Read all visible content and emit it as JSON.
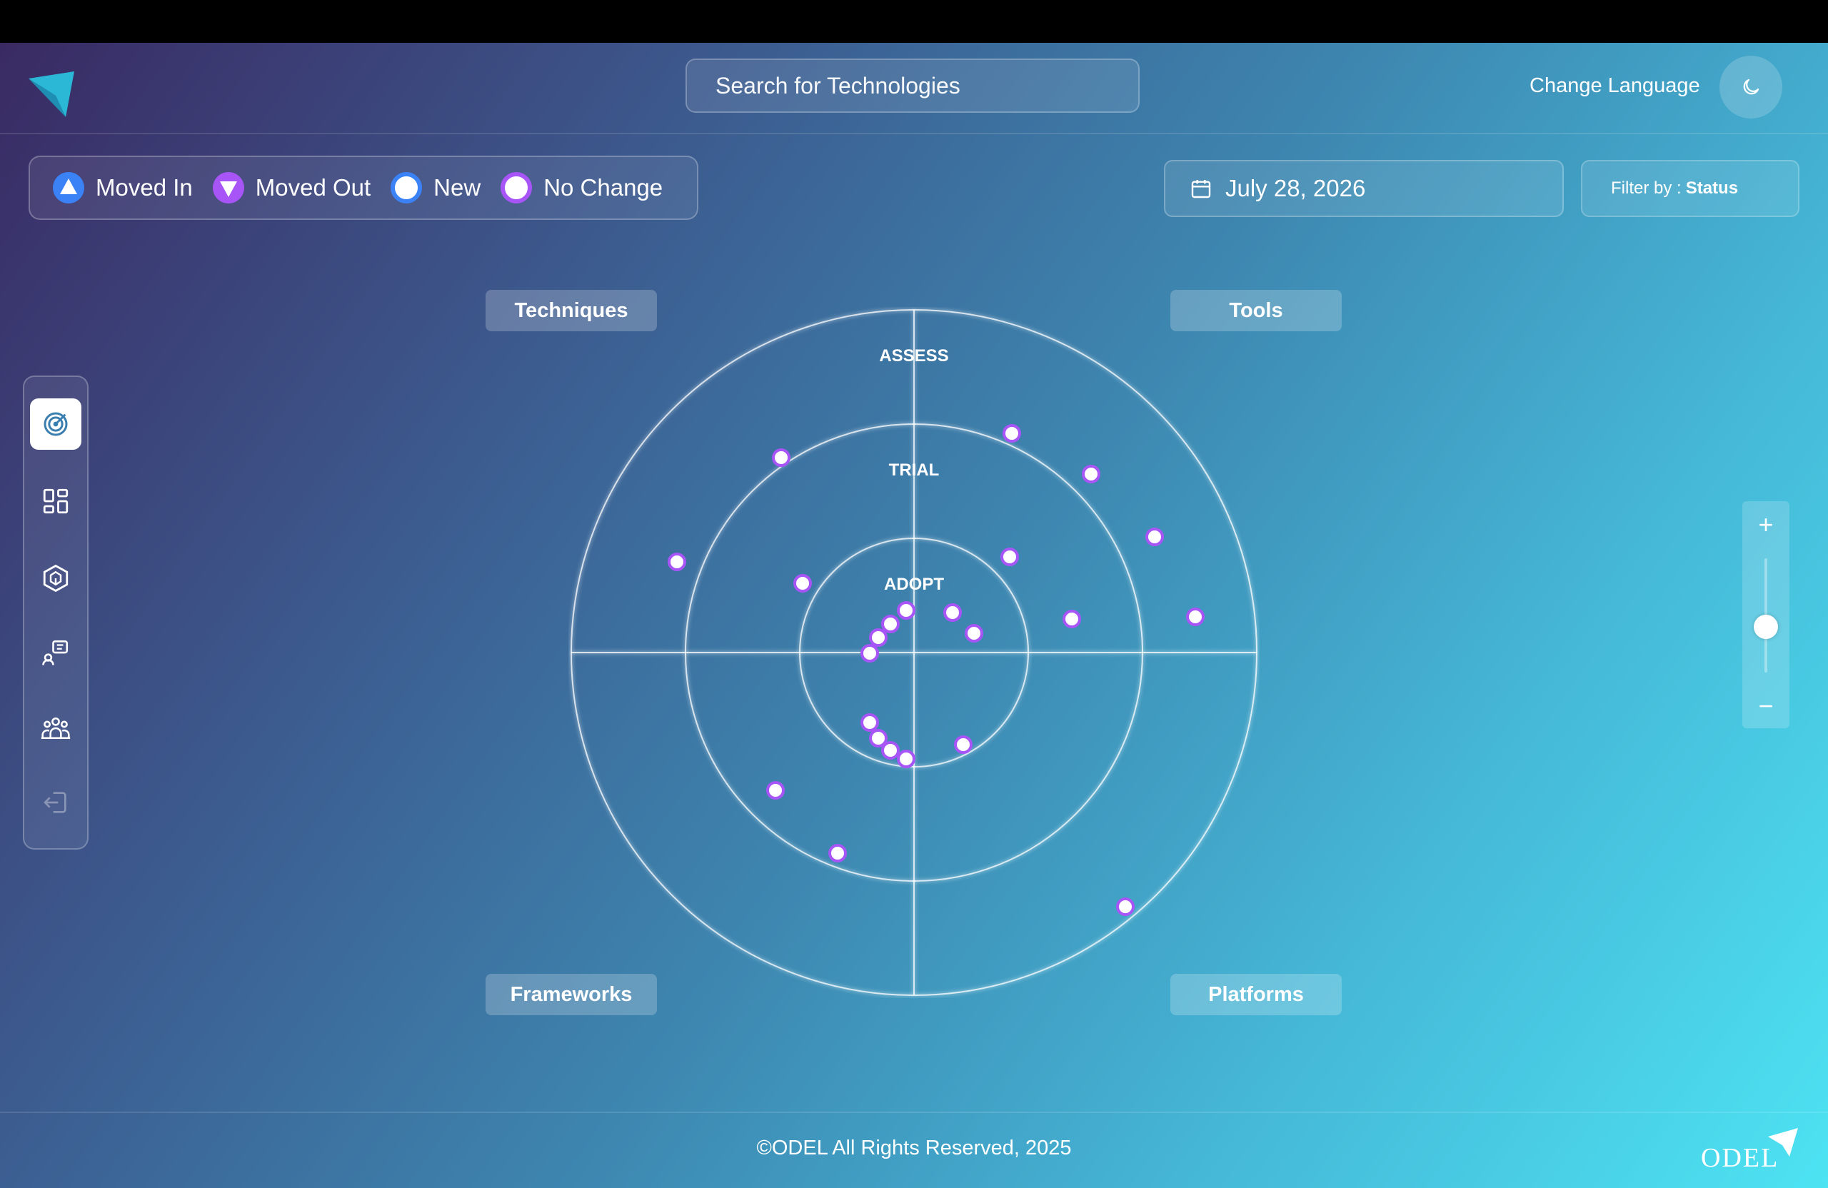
{
  "header": {
    "search_placeholder": "Search for Technologies",
    "change_language": "Change Language",
    "theme_icon": "moon-icon"
  },
  "legend": [
    {
      "label": "Moved In",
      "icon": "triangle-up"
    },
    {
      "label": "Moved Out",
      "icon": "triangle-down"
    },
    {
      "label": "New",
      "icon": "circle-blue-ring"
    },
    {
      "label": "No Change",
      "icon": "circle-purple-ring"
    }
  ],
  "date": "July 28, 2026",
  "filter": {
    "prefix": "Filter by :",
    "value": "Status"
  },
  "sidebar": [
    "radar-icon",
    "dashboard-icon",
    "box-icon",
    "feedback-icon",
    "team-icon",
    "logout-icon"
  ],
  "quadrants": {
    "top_left": "Techniques",
    "top_right": "Tools",
    "bottom_left": "Frameworks",
    "bottom_right": "Platforms"
  },
  "rings": [
    "ADOPT",
    "TRIAL",
    "ASSESS"
  ],
  "colors": {
    "accent": "#a855f7",
    "moved_in": "#3b82f6",
    "blip_fill": "#ffffff"
  },
  "blip_status": "No Change",
  "zoom": {
    "level": 0.4
  },
  "footer": "©ODEL All Rights Reserved, 2025",
  "brand": "ODEL"
}
